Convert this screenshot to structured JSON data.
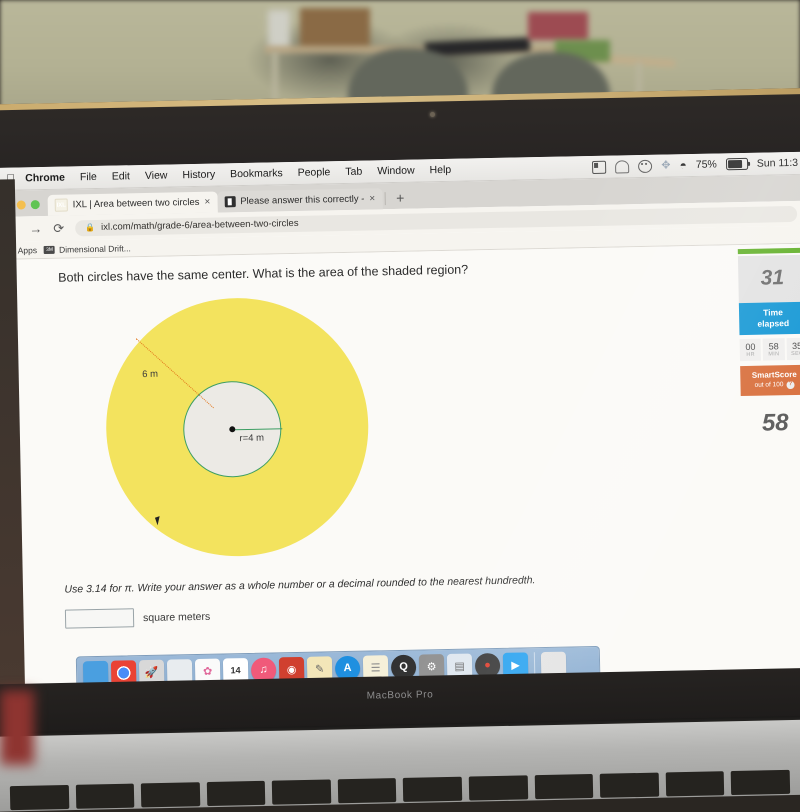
{
  "menubar": {
    "apple_logo": "apple-logo",
    "items": [
      "Chrome",
      "File",
      "Edit",
      "View",
      "History",
      "Bookmarks",
      "People",
      "Tab",
      "Window",
      "Help"
    ],
    "active_app": "Chrome",
    "status": {
      "battery_percent": "75%",
      "datetime": "Sun 11:3",
      "icons": [
        "screen-mirroring-icon",
        "airplay-icon",
        "user-face-icon",
        "bluetooth-icon",
        "wifi-icon",
        "battery-icon"
      ]
    }
  },
  "browser": {
    "window_controls": [
      "close",
      "minimize",
      "maximize"
    ],
    "tabs": [
      {
        "title": "IXL | Area between two circles",
        "favicon": "ixl-favicon",
        "favicon_text": "IXL",
        "active": true,
        "close_label": "×"
      },
      {
        "title": "Please answer this correctly -",
        "favicon": "brainly-favicon",
        "active": false,
        "close_label": "×"
      }
    ],
    "new_tab_label": "+",
    "nav": {
      "back": "←",
      "forward": "→",
      "reload": "⟳"
    },
    "omnibox": {
      "lock_icon": "lock-icon",
      "url": "ixl.com/math/grade-6/area-between-two-circles"
    },
    "bookmarks": [
      {
        "label": "Apps",
        "icon": "apps-grid-icon"
      },
      {
        "label": "Dimensional Drift...",
        "icon": "bookmark-icon"
      }
    ]
  },
  "question": {
    "prompt": "Both circles have the same center. What is the area of the shaded region?",
    "instruction": "Use 3.14 for π. Write your answer as a whole number or a decimal rounded to the nearest hundredth.",
    "answer_value": "",
    "answer_placeholder": "",
    "units": "square meters"
  },
  "figure": {
    "outer_label": "6 m",
    "inner_label": "r=4 m",
    "outer_fill": "#f3e35e",
    "inner_fill": "#eceae5",
    "inner_stroke": "#3d9e63",
    "dashed_color": "#e2761b"
  },
  "score_panel": {
    "question_number": "31",
    "time_header_line1": "Time",
    "time_header_line2": "elapsed",
    "clock": [
      {
        "value": "00",
        "unit": "HR"
      },
      {
        "value": "58",
        "unit": "MIN"
      },
      {
        "value": "35",
        "unit": "SEC"
      }
    ],
    "smartscore_title": "SmartScore",
    "smartscore_subtitle": "out of 100",
    "help_icon": "?",
    "score": "58",
    "progress_color": "#65b22e",
    "time_color": "#1a9ad6",
    "smartscore_color": "#d9713f"
  },
  "dock": {
    "items": [
      {
        "name": "finder-icon",
        "glyph": "🙂",
        "bg": "#4a9fe0"
      },
      {
        "name": "chrome-icon",
        "glyph": "◉",
        "bg": "#f5f5f5"
      },
      {
        "name": "launchpad-icon",
        "glyph": "🚀",
        "bg": "#d8d8d8"
      },
      {
        "name": "preview-icon",
        "glyph": "🖼",
        "bg": "#e8ecef"
      },
      {
        "name": "photos-icon",
        "glyph": "✿",
        "bg": "#fafafa"
      },
      {
        "name": "calendar-icon",
        "glyph": "14",
        "bg": "#ffffff"
      },
      {
        "name": "itunes-icon",
        "glyph": "♫",
        "bg": "#f05a7a"
      },
      {
        "name": "podcasts-icon",
        "glyph": "◎",
        "bg": "#d0402f"
      },
      {
        "name": "notes-icon",
        "glyph": "✎",
        "bg": "#f3e6b8"
      },
      {
        "name": "app-store-icon",
        "glyph": "A",
        "bg": "#1e8fe0"
      },
      {
        "name": "stickies-icon",
        "glyph": "☰",
        "bg": "#f5f0d8"
      },
      {
        "name": "quicktime-icon",
        "glyph": "Q",
        "bg": "#2b2b2b"
      },
      {
        "name": "system-preferences-icon",
        "glyph": "⚙",
        "bg": "#8e8e8e"
      },
      {
        "name": "keynote-icon",
        "glyph": "▤",
        "bg": "#dfe7ef"
      },
      {
        "name": "disc-burner-icon",
        "glyph": "●",
        "bg": "#3a3a3a"
      },
      {
        "name": "facetime-icon",
        "glyph": "▶",
        "bg": "#2aa3f0"
      }
    ],
    "trash": {
      "name": "trash-icon",
      "glyph": "□",
      "bg": "#e4e4e4"
    }
  },
  "laptop": {
    "model": "MacBook Pro"
  }
}
